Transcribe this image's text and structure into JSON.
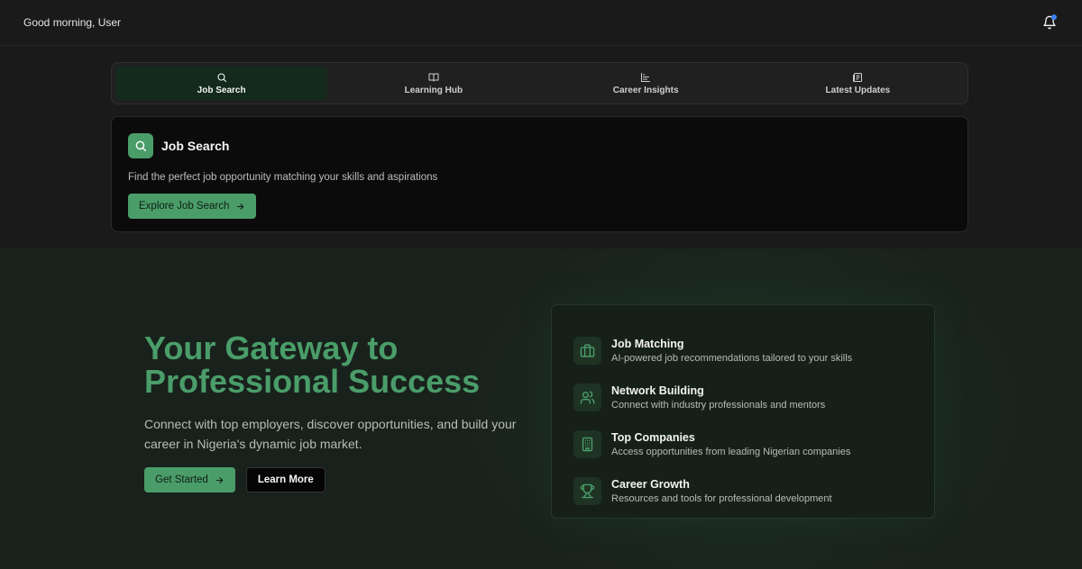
{
  "header": {
    "greeting": "Good morning, User",
    "notification_icon": "bell-icon"
  },
  "tabs": [
    {
      "label": "Job Search",
      "icon": "search-icon",
      "active": true
    },
    {
      "label": "Learning Hub",
      "icon": "book-icon",
      "active": false
    },
    {
      "label": "Career Insights",
      "icon": "chart-icon",
      "active": false
    },
    {
      "label": "Latest Updates",
      "icon": "newspaper-icon",
      "active": false
    }
  ],
  "card": {
    "title": "Job Search",
    "description": "Find the perfect job opportunity matching your skills and aspirations",
    "button_label": "Explore Job Search"
  },
  "hero": {
    "title": "Your Gateway to Professional Success",
    "subtitle": "Connect with top employers, discover opportunities, and build your career in Nigeria's dynamic job market.",
    "primary_button": "Get Started",
    "secondary_button": "Learn More"
  },
  "features": [
    {
      "title": "Job Matching",
      "description": "AI-powered job recommendations tailored to your skills",
      "icon": "briefcase-icon"
    },
    {
      "title": "Network Building",
      "description": "Connect with industry professionals and mentors",
      "icon": "users-icon"
    },
    {
      "title": "Top Companies",
      "description": "Access opportunities from leading Nigerian companies",
      "icon": "building-icon"
    },
    {
      "title": "Career Growth",
      "description": "Resources and tools for professional development",
      "icon": "trophy-icon"
    }
  ],
  "colors": {
    "accent": "#4a9d69",
    "background": "#1a1a1a",
    "notification_dot": "#3b82f6"
  }
}
